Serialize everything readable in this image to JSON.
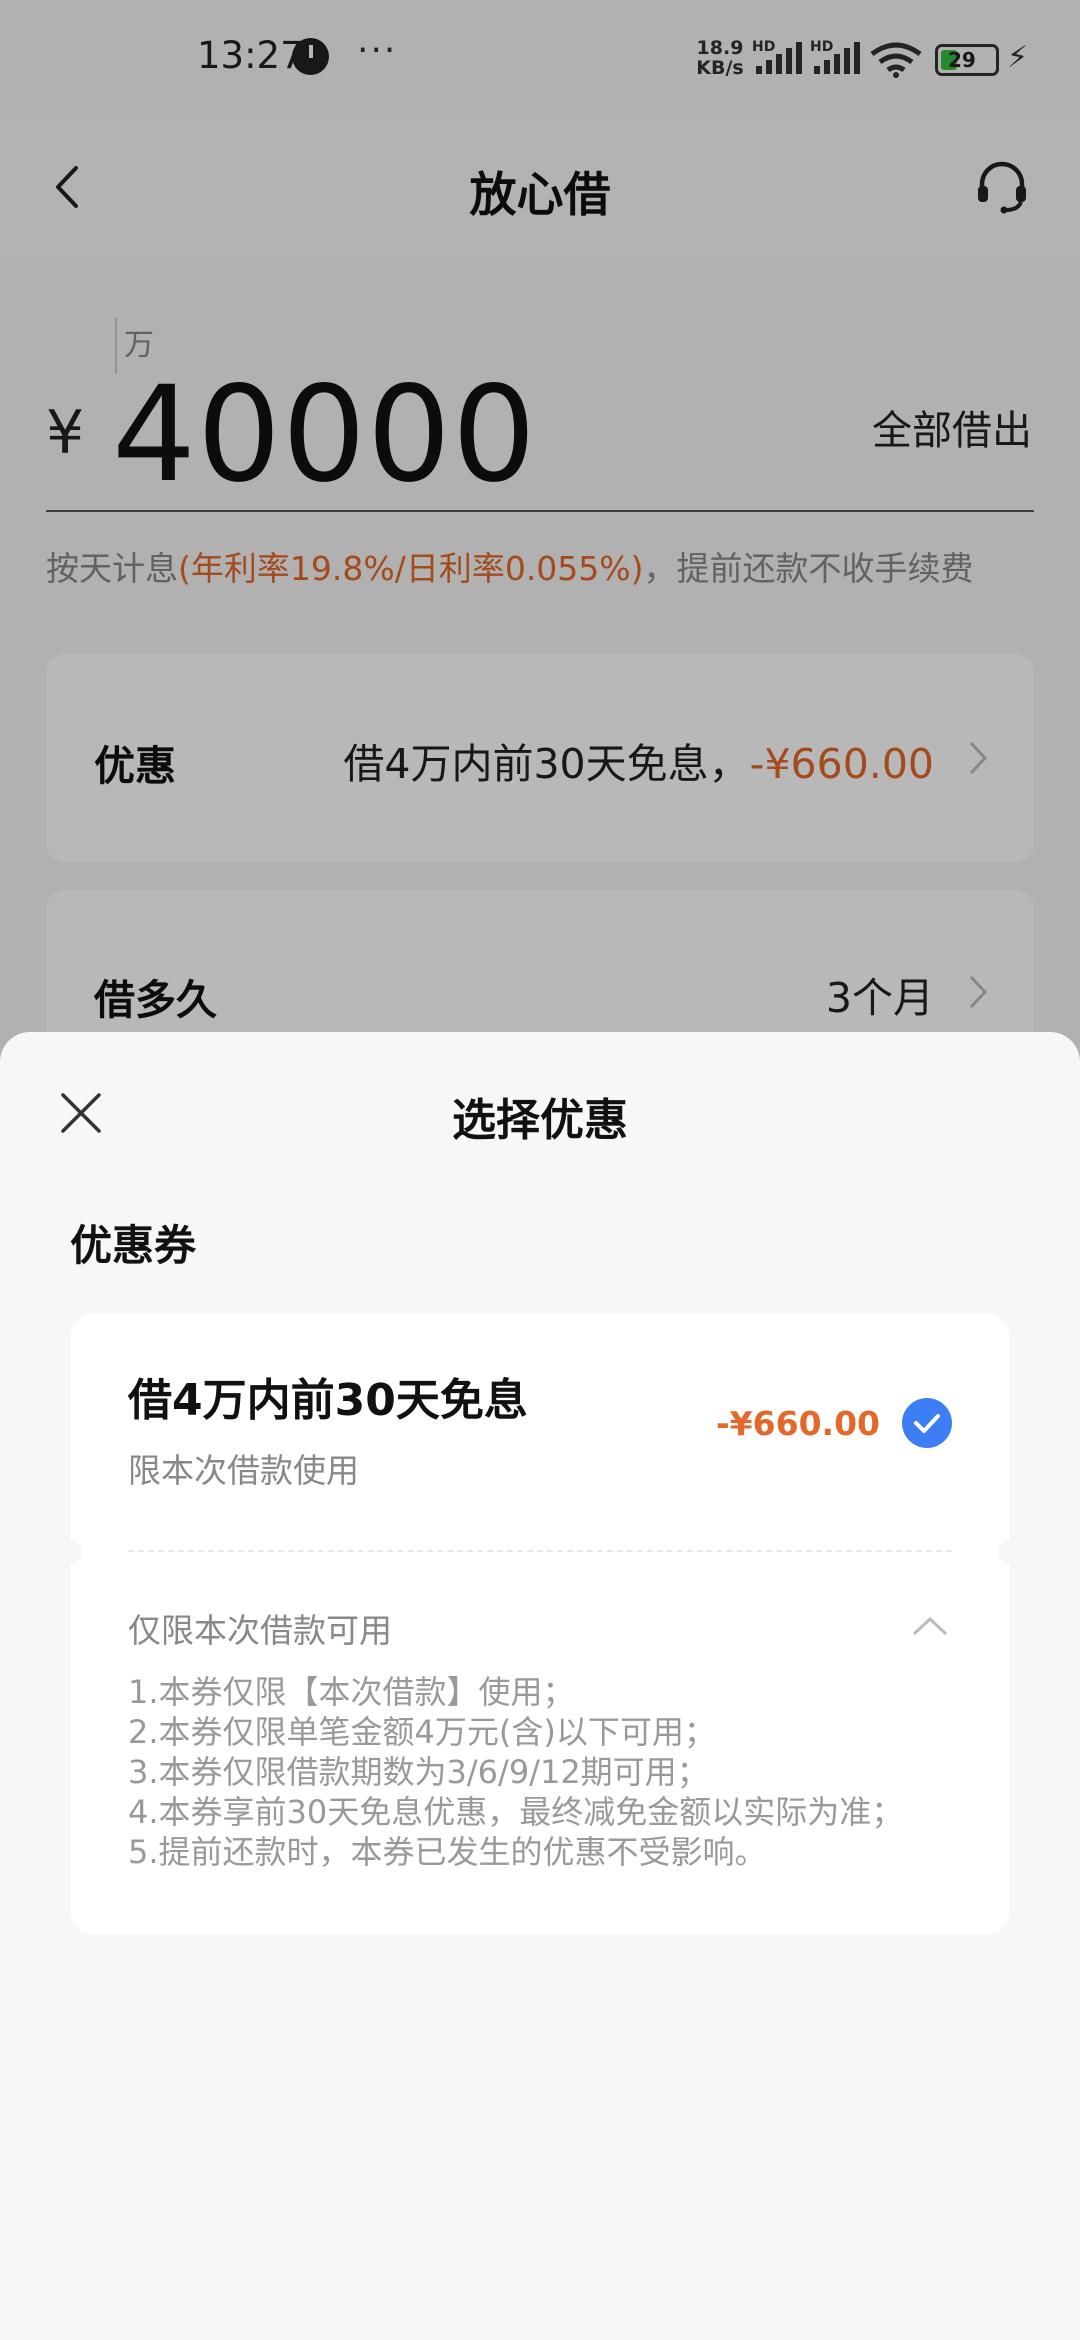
{
  "status_bar": {
    "time": "13:27",
    "more": "···",
    "speed_value": "18.9",
    "speed_unit": "KB/s",
    "hd1": "HD",
    "hd2": "HD",
    "battery": "29",
    "bolt": "⚡"
  },
  "header": {
    "title": "放心借"
  },
  "amount": {
    "unit": "万",
    "currency": "¥",
    "value": "40000",
    "borrow_all": "全部借出",
    "interest_prefix": "按天计息",
    "interest_rate": "(年利率19.8%/日利率0.055%)",
    "interest_suffix": "，提前还款不收手续费"
  },
  "discount_card": {
    "label": "优惠",
    "value_text": "借4万内前30天免息，",
    "value_amount": "-¥660.00"
  },
  "duration_card": {
    "label": "借多久",
    "value": "3个月"
  },
  "sheet": {
    "title": "选择优惠",
    "section": "优惠券",
    "coupon": {
      "name": "借4万内前30天免息",
      "sub": "限本次借款使用",
      "amount": "-¥660.00",
      "selected": true,
      "rules_title": "仅限本次借款可用",
      "rules": [
        "1.本券仅限【本次借款】使用；",
        "2.本券仅限单笔金额4万元(含)以下可用；",
        "3.本券仅限借款期数为3/6/9/12期可用；",
        "4.本券享前30天免息优惠，最终减免金额以实际为准；",
        "5.提前还款时，本券已发生的优惠不受影响。"
      ]
    }
  },
  "colors": {
    "accent_orange": "#e4682a",
    "check_blue": "#3d7ef5"
  },
  "icons": [
    "clock-icon",
    "signal-icon",
    "wifi-icon",
    "battery-icon",
    "back-icon",
    "headset-icon",
    "chevron-right-icon",
    "close-icon",
    "check-icon",
    "chevron-up-icon"
  ]
}
